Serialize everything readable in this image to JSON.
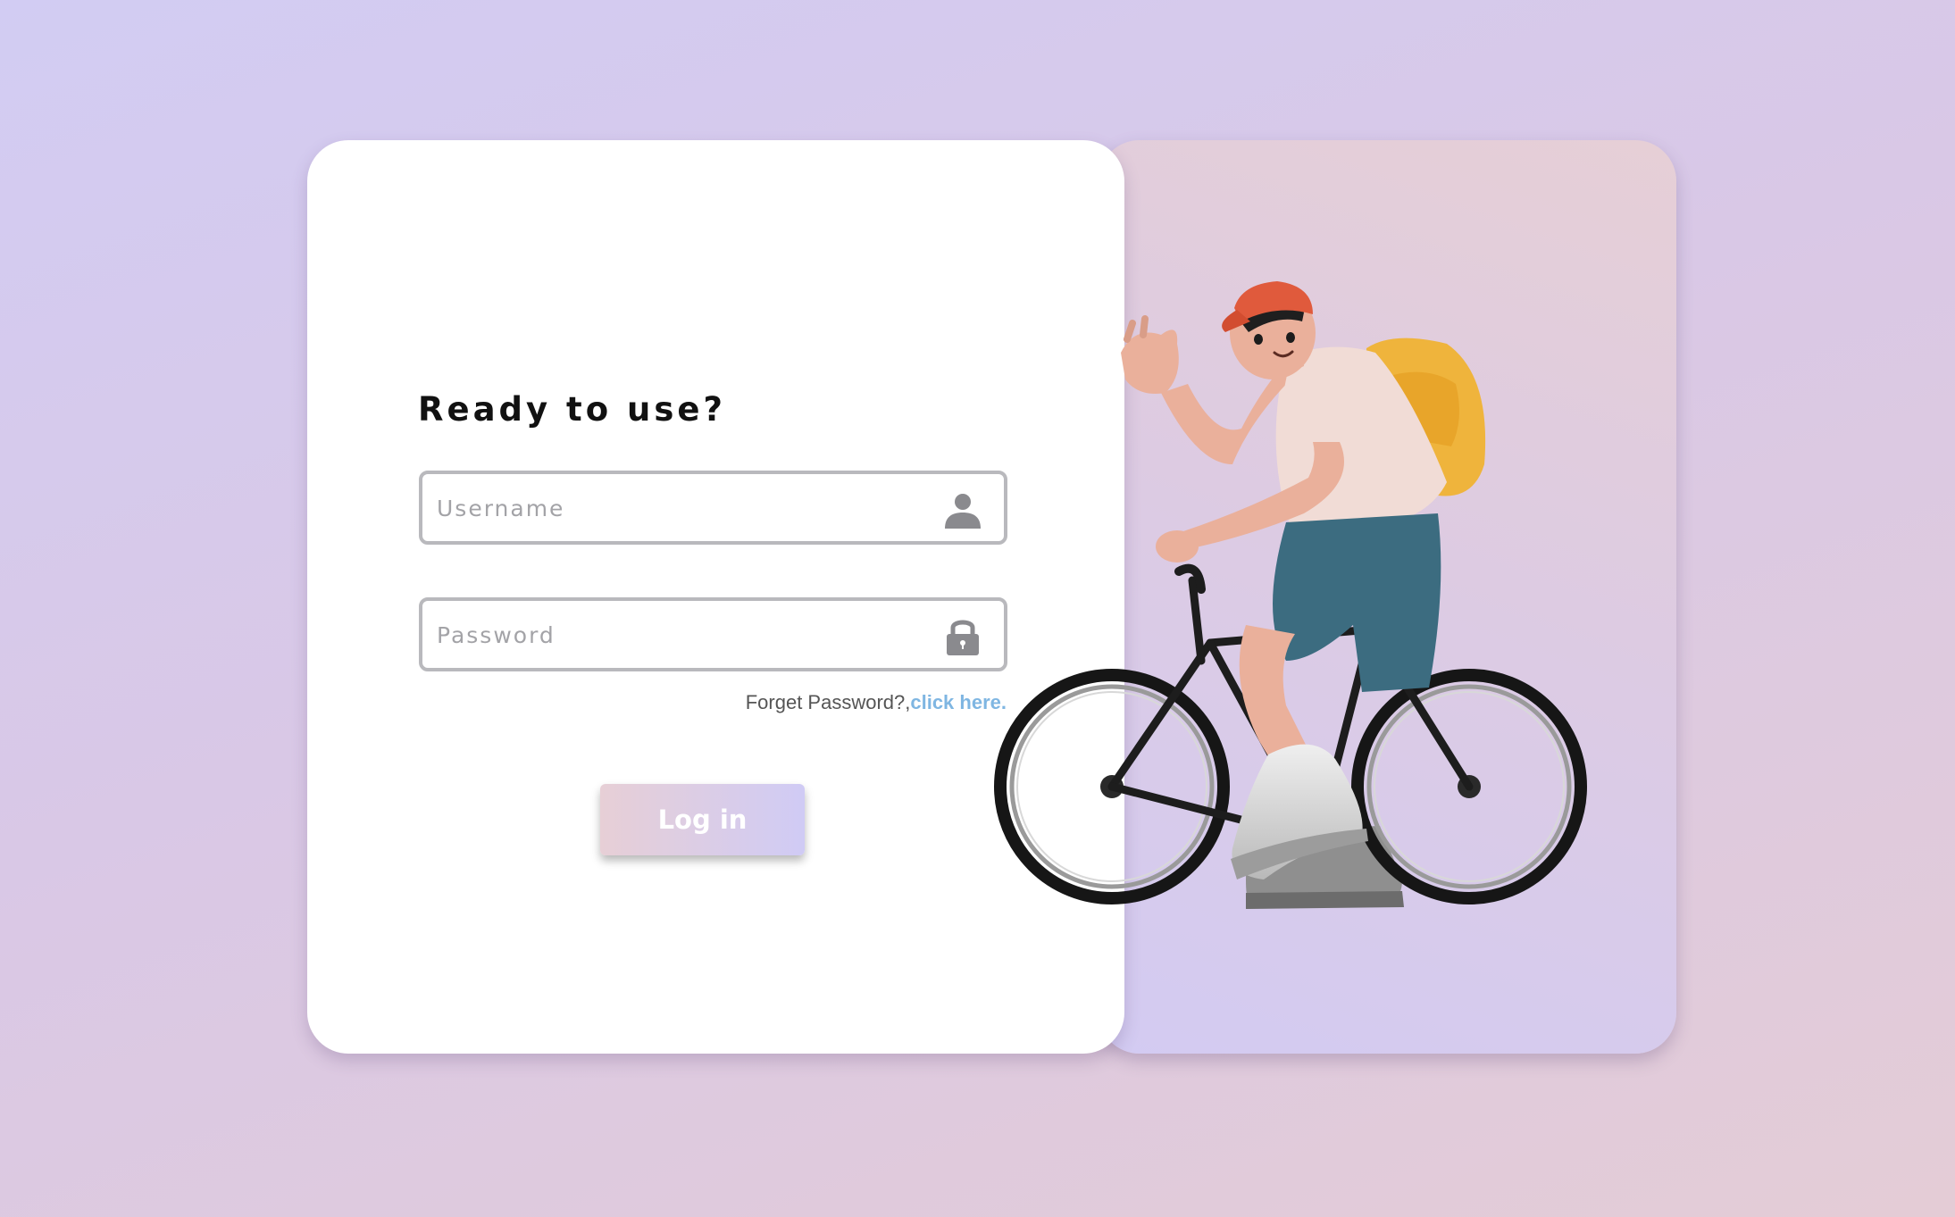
{
  "form": {
    "heading": "Ready to use?",
    "username": {
      "placeholder": "Username",
      "value": "",
      "icon": "user-icon"
    },
    "password": {
      "placeholder": "Password",
      "value": "",
      "icon": "lock-icon"
    },
    "forgot_prefix": "Forget Password?,",
    "forgot_link": "click here.",
    "login_label": "Log in"
  },
  "illustration": {
    "subject": "person-on-bicycle-waving"
  },
  "colors": {
    "link": "#7fb6e2",
    "button_gradient_start": "#e7cfd6",
    "button_gradient_end": "#d0cbf5",
    "cap": "#e05a3c",
    "backpack": "#efb43c",
    "shorts": "#3c6c80",
    "shirt": "#f1dcd6",
    "skin": "#eab09b"
  }
}
